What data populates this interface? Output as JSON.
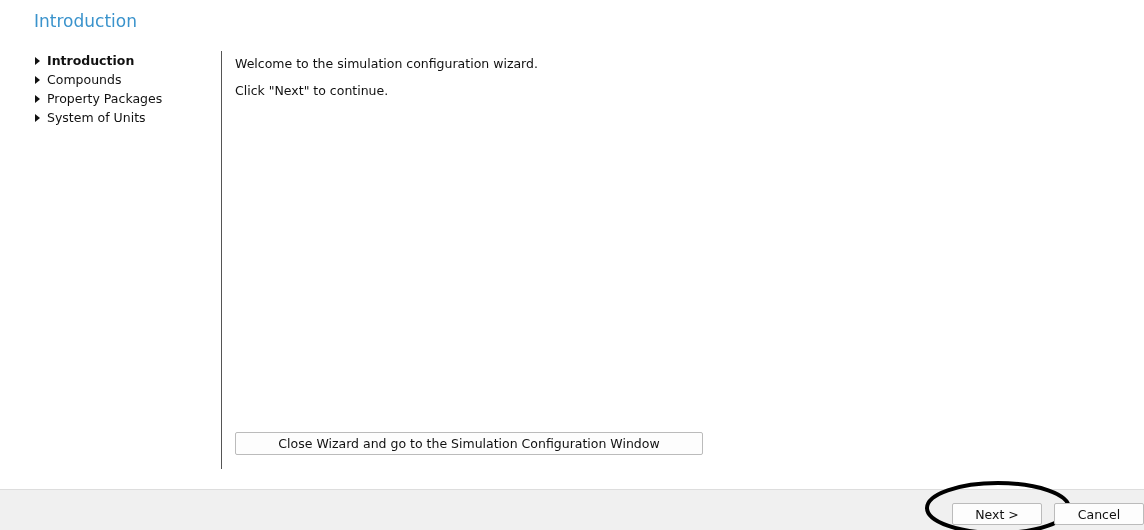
{
  "page_title": "Introduction",
  "steps": [
    {
      "label": "Introduction",
      "selected": true
    },
    {
      "label": "Compounds",
      "selected": false
    },
    {
      "label": "Property Packages",
      "selected": false
    },
    {
      "label": "System of Units",
      "selected": false
    }
  ],
  "content": {
    "paragraphs": [
      "Welcome to the simulation configuration wizard.",
      "Click \"Next\" to continue."
    ],
    "close_button": "Close Wizard and go to the Simulation Configuration Window"
  },
  "footer": {
    "buttons": [
      {
        "label": "Next >",
        "circled": true
      },
      {
        "label": "Cancel",
        "circled": false
      }
    ]
  }
}
